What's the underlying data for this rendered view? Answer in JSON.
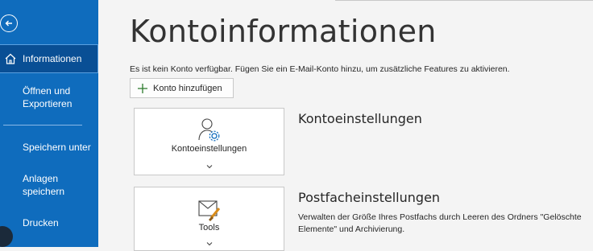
{
  "sidebar": {
    "back_icon": "back-arrow-icon",
    "items": [
      {
        "label": "Informationen",
        "icon": "home-icon",
        "active": true
      },
      {
        "label": "Öffnen und Exportieren"
      },
      {
        "label": "Speichern unter"
      },
      {
        "label": "Anlagen speichern"
      },
      {
        "label": "Drucken"
      }
    ]
  },
  "main": {
    "title": "Kontoinformationen",
    "info_text": "Es ist kein Konto verfügbar. Fügen Sie ein E-Mail-Konto hinzu, um zusätzliche Features zu aktivieren.",
    "add_account_label": "Konto hinzufügen",
    "sections": [
      {
        "card_label": "Kontoeinstellungen",
        "card_icon": "account-settings-icon",
        "title": "Kontoeinstellungen",
        "description": ""
      },
      {
        "card_label": "Tools",
        "card_icon": "tools-mailbox-icon",
        "title": "Postfacheinstellungen",
        "description": "Verwalten der Größe Ihres Postfachs durch Leeren des Ordners \"Gelöschte Elemente\" und Archivierung."
      }
    ]
  },
  "colors": {
    "sidebar_bg": "#0f6cbd",
    "sidebar_active": "#094f95",
    "page_bg": "#f4f4f4"
  }
}
